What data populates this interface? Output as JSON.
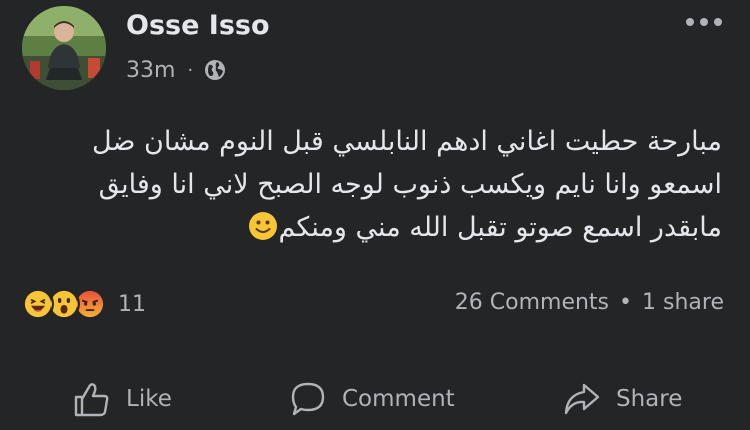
{
  "post": {
    "author": "Osse Isso",
    "time": "33m",
    "privacy_icon": "globe-icon",
    "text_lines": [
      "مبارحة حطيت اغاني ادهم النابلسي قبل النوم مشان ضل",
      "اسمعو وانا نايم ويكسب ذنوب لوجه الصبح لاني انا وفايق",
      "مابقدر اسمع صوتو تقبل الله مني ومنكم"
    ],
    "emoji": "slightly-smiling-face-emoji"
  },
  "reactions": {
    "icons": [
      "haha-reaction-icon",
      "wow-reaction-icon",
      "angry-reaction-icon"
    ],
    "count": "11"
  },
  "stats": {
    "comments": "26 Comments",
    "separator": "•",
    "shares": "1 share"
  },
  "actions": {
    "like": "Like",
    "comment": "Comment",
    "share": "Share"
  },
  "colors": {
    "background": "#242526",
    "primary_text": "#e4e6eb",
    "secondary_text": "#b0b3b8"
  }
}
